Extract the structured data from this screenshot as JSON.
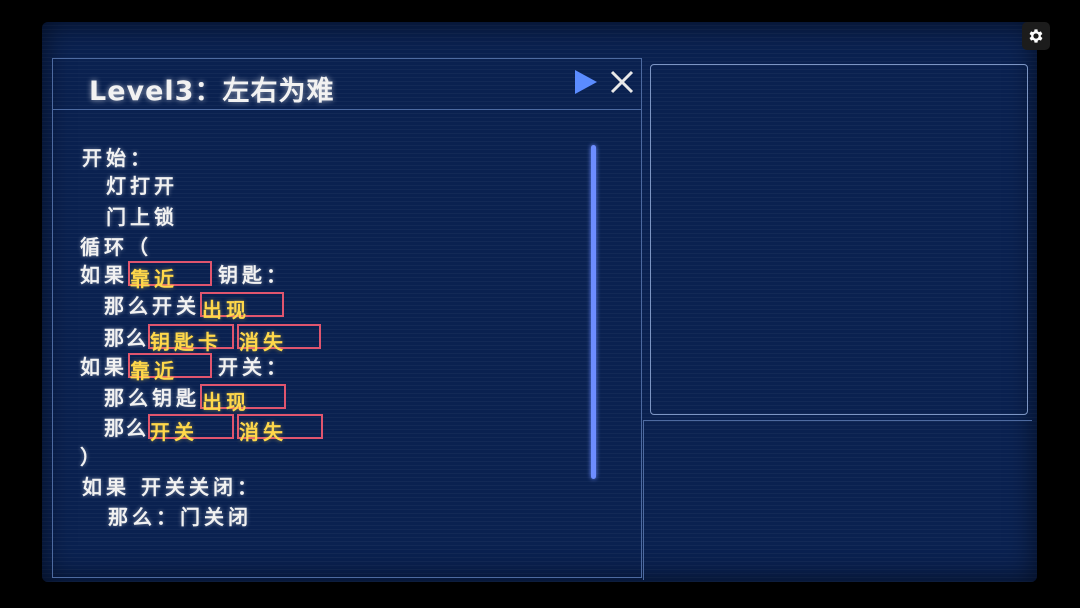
{
  "level": {
    "title": "Level3：左右为难"
  },
  "colors": {
    "background": "#0a2150",
    "text": "#f2f2f2",
    "slot_border": "#e0556e",
    "slot_text": "#ffd84a",
    "accent": "#6d8dff"
  },
  "icons": {
    "settings": "gear-icon",
    "run": "play-icon",
    "close": "close-icon"
  },
  "code": {
    "l1": {
      "text": "开始："
    },
    "l2": {
      "text": "灯打开"
    },
    "l3": {
      "text": "门上锁"
    },
    "l4": {
      "text": "循环（"
    },
    "l5": {
      "pre": "如果",
      "slot1": "靠近",
      "post": "钥匙："
    },
    "l6": {
      "pre": "那么开关",
      "slot1": "出现"
    },
    "l7": {
      "pre": "那么",
      "slot1": "钥匙卡",
      "slot2": "消失"
    },
    "l8": {
      "pre": "如果",
      "slot1": "靠近",
      "post": "开关："
    },
    "l9": {
      "pre": "那么钥匙",
      "slot1": "出现"
    },
    "l10": {
      "pre": "那么",
      "slot1": "开关",
      "slot2": "消失"
    },
    "l11": {
      "text": "）"
    },
    "l12": {
      "text": "如果 开关关闭："
    },
    "l13": {
      "text": "那么：门关闭"
    }
  }
}
